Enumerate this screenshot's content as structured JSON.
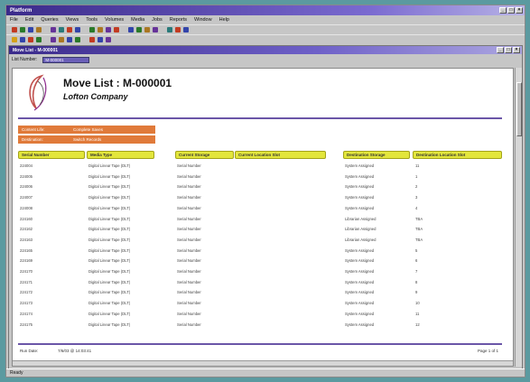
{
  "app": {
    "title": "Platform",
    "min_glyph": "_",
    "max_glyph": "□",
    "close_glyph": "×"
  },
  "menu": [
    "File",
    "Edit",
    "Queries",
    "Views",
    "Tools",
    "Volumes",
    "Media",
    "Jobs",
    "Reports",
    "Window",
    "Help"
  ],
  "toolbar": {
    "row1_colors": [
      "#c23b22",
      "#2a7a2a",
      "#3344aa",
      "#aa7722",
      "#663399",
      "#2a7a7a",
      "#c23b22",
      "#3344aa",
      "#2a7a2a",
      "#aa7722",
      "#663399",
      "#c23b22",
      "#3344aa",
      "#2a7a2a",
      "#aa7722",
      "#663399",
      "#2a7a7a",
      "#c23b22",
      "#3344aa"
    ],
    "row2_colors": [
      "#d4a017",
      "#3344aa",
      "#c23b22",
      "#2a7a2a",
      "#663399",
      "#aa7722",
      "#3344aa",
      "#2a7a2a",
      "#c23b22",
      "#3344aa",
      "#663399"
    ]
  },
  "child_window": {
    "title": "Move List - M-000001"
  },
  "filter": {
    "label": "List Number:",
    "value": "M-000001"
  },
  "report": {
    "title": "Move List : M-000001",
    "company": "Lofton Company",
    "info_rows": [
      {
        "label": "Content Life:",
        "value": "Complete Saves"
      },
      {
        "label": "Destination:",
        "value": "Switch Records"
      }
    ],
    "columns": [
      "Serial Number",
      "Media Type",
      "Current Storage",
      "Current Location Slot",
      "Destination Storage",
      "Destination Location Slot"
    ],
    "rows": [
      [
        "224004",
        "Digital Linear Tape (DLT)",
        "Serial Number",
        "",
        "System Assigned",
        "11"
      ],
      [
        "224005",
        "Digital Linear Tape (DLT)",
        "Serial Number",
        "",
        "System Assigned",
        "1"
      ],
      [
        "224006",
        "Digital Linear Tape (DLT)",
        "Serial Number",
        "",
        "System Assigned",
        "2"
      ],
      [
        "224007",
        "Digital Linear Tape (DLT)",
        "Serial Number",
        "",
        "System Assigned",
        "3"
      ],
      [
        "224008",
        "Digital Linear Tape (DLT)",
        "Serial Number",
        "",
        "System Assigned",
        "4"
      ],
      [
        "224160",
        "Digital Linear Tape (DLT)",
        "Serial Number",
        "",
        "Librarian Assigned",
        "TBA"
      ],
      [
        "224162",
        "Digital Linear Tape (DLT)",
        "Serial Number",
        "",
        "Librarian Assigned",
        "TBA"
      ],
      [
        "224163",
        "Digital Linear Tape (DLT)",
        "Serial Number",
        "",
        "Librarian Assigned",
        "TBA"
      ],
      [
        "224165",
        "Digital Linear Tape (DLT)",
        "Serial Number",
        "",
        "System Assigned",
        "5"
      ],
      [
        "224169",
        "Digital Linear Tape (DLT)",
        "Serial Number",
        "",
        "System Assigned",
        "6"
      ],
      [
        "224170",
        "Digital Linear Tape (DLT)",
        "Serial Number",
        "",
        "System Assigned",
        "7"
      ],
      [
        "224171",
        "Digital Linear Tape (DLT)",
        "Serial Number",
        "",
        "System Assigned",
        "8"
      ],
      [
        "224172",
        "Digital Linear Tape (DLT)",
        "Serial Number",
        "",
        "System Assigned",
        "9"
      ],
      [
        "224173",
        "Digital Linear Tape (DLT)",
        "Serial Number",
        "",
        "System Assigned",
        "10"
      ],
      [
        "224174",
        "Digital Linear Tape (DLT)",
        "Serial Number",
        "",
        "System Assigned",
        "11"
      ],
      [
        "224175",
        "Digital Linear Tape (DLT)",
        "Serial Number",
        "",
        "System Assigned",
        "12"
      ]
    ],
    "footer": {
      "label": "Run Date:",
      "date": "7/6/03 @ 14:03:41",
      "page": "Page 1 of 1"
    }
  },
  "status": {
    "text": "Ready"
  }
}
